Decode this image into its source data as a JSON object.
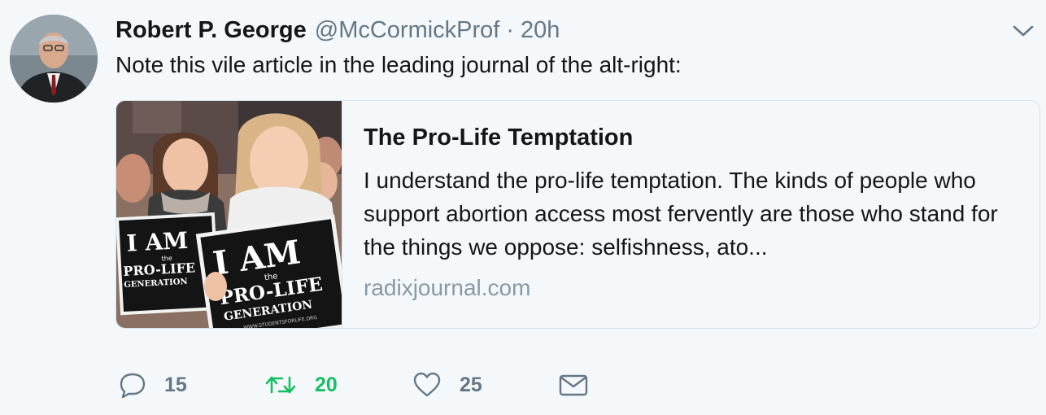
{
  "tweet": {
    "author_name": "Robert P. George",
    "handle": "@McCormickProf",
    "separator": "·",
    "time": "20h",
    "text": "Note this vile article in the leading journal of the alt-right:"
  },
  "card": {
    "title": "The Pro-Life Temptation",
    "description": "I understand the pro-life temptation. The kinds of people who support abortion access most fervently are those who stand for the things we oppose: selfishness, ato...",
    "domain": "radixjournal.com",
    "image_sign_text": {
      "line1": "I AM",
      "line2": "the",
      "line3": "PRO-LIFE",
      "line4": "GENERATION",
      "line5": "WWW.STUDENTSFORLIFE.ORG"
    }
  },
  "actions": {
    "reply_count": "15",
    "retweet_count": "20",
    "like_count": "25"
  },
  "icons": {
    "reply": "reply-icon",
    "retweet": "retweet-icon",
    "like": "heart-icon",
    "message": "envelope-icon",
    "caret": "chevron-down-icon"
  },
  "colors": {
    "background": "#f5f8fa",
    "text": "#14171a",
    "secondary": "#657786",
    "domain": "#8899a6",
    "retweet_active": "#17bf63"
  }
}
